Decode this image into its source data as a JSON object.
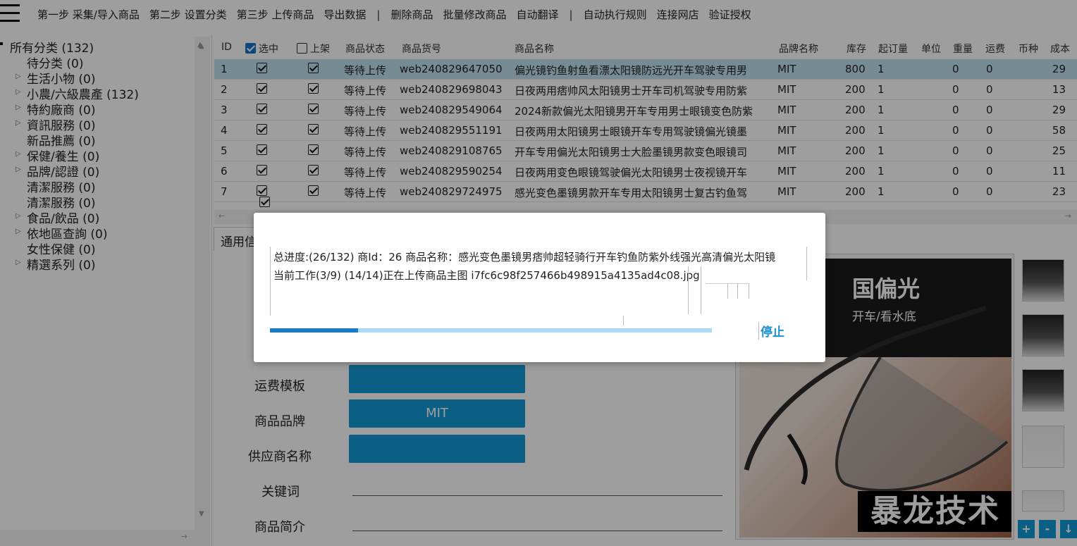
{
  "toolbar": {
    "items": [
      "第一步 采集/导入商品",
      "第二步 设置分类",
      "第三步 上传商品",
      "导出数据",
      "|",
      "删除商品",
      "批量修改商品",
      "自动翻译",
      "|",
      "自动执行规则",
      "连接网店",
      "验证授权"
    ]
  },
  "tree": {
    "root": "所有分类 (132)",
    "items": [
      {
        "label": "待分类 (0)",
        "expandable": false
      },
      {
        "label": "生活小物 (0)",
        "expandable": true
      },
      {
        "label": "小農/六級農產 (132)",
        "expandable": true
      },
      {
        "label": "特約廠商 (0)",
        "expandable": true
      },
      {
        "label": "資訊服務 (0)",
        "expandable": true
      },
      {
        "label": "新品推薦 (0)",
        "expandable": false
      },
      {
        "label": "保健/養生 (0)",
        "expandable": true
      },
      {
        "label": "品牌/認證 (0)",
        "expandable": true
      },
      {
        "label": "清潔服務 (0)",
        "expandable": false
      },
      {
        "label": "清潔服務 (0)",
        "expandable": false
      },
      {
        "label": "食品/飲品 (0)",
        "expandable": true
      },
      {
        "label": "依地區查詢 (0)",
        "expandable": true
      },
      {
        "label": "女性保健 (0)",
        "expandable": false
      },
      {
        "label": "精選系列 (0)",
        "expandable": true
      }
    ]
  },
  "grid": {
    "headers": {
      "id": "ID",
      "selected": "选中",
      "listed": "上架",
      "status": "商品状态",
      "sku": "商品货号",
      "name": "商品名称",
      "brand": "品牌名称",
      "stock": "库存",
      "moq": "起订量",
      "unit": "单位",
      "weight": "重量",
      "shipping": "运费",
      "currency": "币种",
      "cost": "成本"
    },
    "header_checks": {
      "selected": true,
      "listed": false
    },
    "rows": [
      {
        "id": "1",
        "status": "等待上传",
        "sku": "web240829647050",
        "name": "偏光镜钓鱼射鱼看漂太阳镜防远光开车驾驶专用男",
        "brand": "MIT",
        "stock": "800",
        "moq": "1",
        "weight": "0",
        "shipping": "0",
        "cost": "29"
      },
      {
        "id": "2",
        "status": "等待上传",
        "sku": "web240829698043",
        "name": "日夜两用痞帅风太阳镜男士开车司机驾驶专用防紫",
        "brand": "MIT",
        "stock": "200",
        "moq": "1",
        "weight": "0",
        "shipping": "0",
        "cost": "13"
      },
      {
        "id": "3",
        "status": "等待上传",
        "sku": "web240829549064",
        "name": "2024新款偏光太阳镜男开车专用男士眼镜变色防紫",
        "brand": "MIT",
        "stock": "200",
        "moq": "1",
        "weight": "0",
        "shipping": "0",
        "cost": "29"
      },
      {
        "id": "4",
        "status": "等待上传",
        "sku": "web240829551191",
        "name": "日夜两用太阳镜男士眼镜开车专用驾驶镜偏光镜墨",
        "brand": "MIT",
        "stock": "200",
        "moq": "1",
        "weight": "0",
        "shipping": "0",
        "cost": "58"
      },
      {
        "id": "5",
        "status": "等待上传",
        "sku": "web240829108765",
        "name": "开车专用偏光太阳镜男士大脸墨镜男款变色眼镜司",
        "brand": "MIT",
        "stock": "200",
        "moq": "1",
        "weight": "0",
        "shipping": "0",
        "cost": "25"
      },
      {
        "id": "6",
        "status": "等待上传",
        "sku": "web240829590254",
        "name": "日夜两用变色眼镜驾驶偏光太阳镜男士夜视镜开车",
        "brand": "MIT",
        "stock": "200",
        "moq": "1",
        "weight": "0",
        "shipping": "0",
        "cost": "11"
      },
      {
        "id": "7",
        "status": "等待上传",
        "sku": "web240829724975",
        "name": "感光变色墨镜男款开车专用太阳镜男士复古钓鱼驾",
        "brand": "MIT",
        "stock": "200",
        "moq": "1",
        "weight": "0",
        "shipping": "0",
        "cost": "23"
      }
    ]
  },
  "detail": {
    "tab_label": "通用信",
    "labels": {
      "shipping_template": "运费模板",
      "brand": "商品品牌",
      "supplier": "供应商名称",
      "keywords": "关键词",
      "intro": "商品简介"
    },
    "brand_value": "MIT"
  },
  "image": {
    "headline": "国偏光",
    "subline": "开车/看水底",
    "watermark": "暴龙技术"
  },
  "thumb_buttons": [
    "+",
    "-",
    "↓"
  ],
  "modal": {
    "line1": "总进度:(26/132) 商Id：26 商品名称：感光变色墨镜男痞帅超轻骑行开车钓鱼防紫外线强光高清偏光太阳镜",
    "line2": "当前工作(3/9) (14/14)正在上传商品主图 i7fc6c98f257466b498915a4135ad4c08.jpg",
    "progress": 0.2,
    "stop_label": "停止"
  },
  "colors": {
    "accent": "#1499d6",
    "selected_row": "#bfe0ef",
    "progress": "#1a7cc4"
  }
}
